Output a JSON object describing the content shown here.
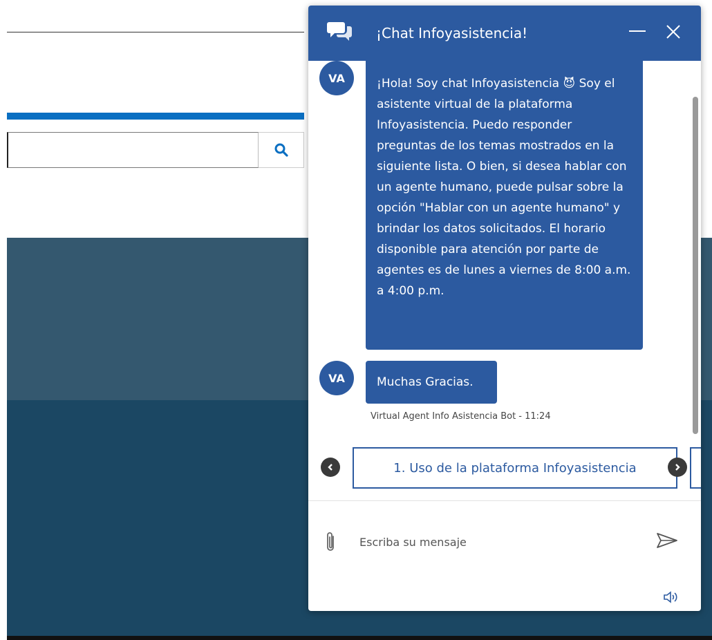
{
  "background": {
    "search": {
      "placeholder": ""
    }
  },
  "chat": {
    "title": "¡Chat Infoyasistencia!",
    "messages": [
      {
        "avatar": "VA",
        "text": "¡Hola! Soy chat Infoyasistencia 😈 Soy el asistente virtual de la plataforma Infoyasistencia. Puedo responder preguntas de los temas mostrados en la siguiente lista. O bien, si desea hablar con un agente humano, puede pulsar sobre la opción \"Hablar con un agente humano\" y brindar los datos solicitados. El horario disponible para atención por parte de agentes es de lunes a viernes de 8:00 a.m. a 4:00 p.m."
      },
      {
        "avatar": "VA",
        "text": "Muchas Gracias.",
        "meta": "Virtual Agent Info Asistencia Bot - 11:24"
      }
    ],
    "carousel": {
      "options": [
        "1. Uso de la plataforma Infoyasistencia"
      ]
    },
    "composer": {
      "placeholder": "Escriba su mensaje"
    },
    "icons": {
      "header": "chat-bubbles-icon",
      "minimize": "minimize-icon",
      "close": "close-icon",
      "attach": "paperclip-icon",
      "send": "send-icon",
      "speaker": "speaker-icon",
      "search": "search-icon"
    },
    "colors": {
      "primary": "#2c5aa0",
      "band_light": "#34586f",
      "band_dark": "#1b4763",
      "accent_bar": "#0a6fc2"
    }
  }
}
